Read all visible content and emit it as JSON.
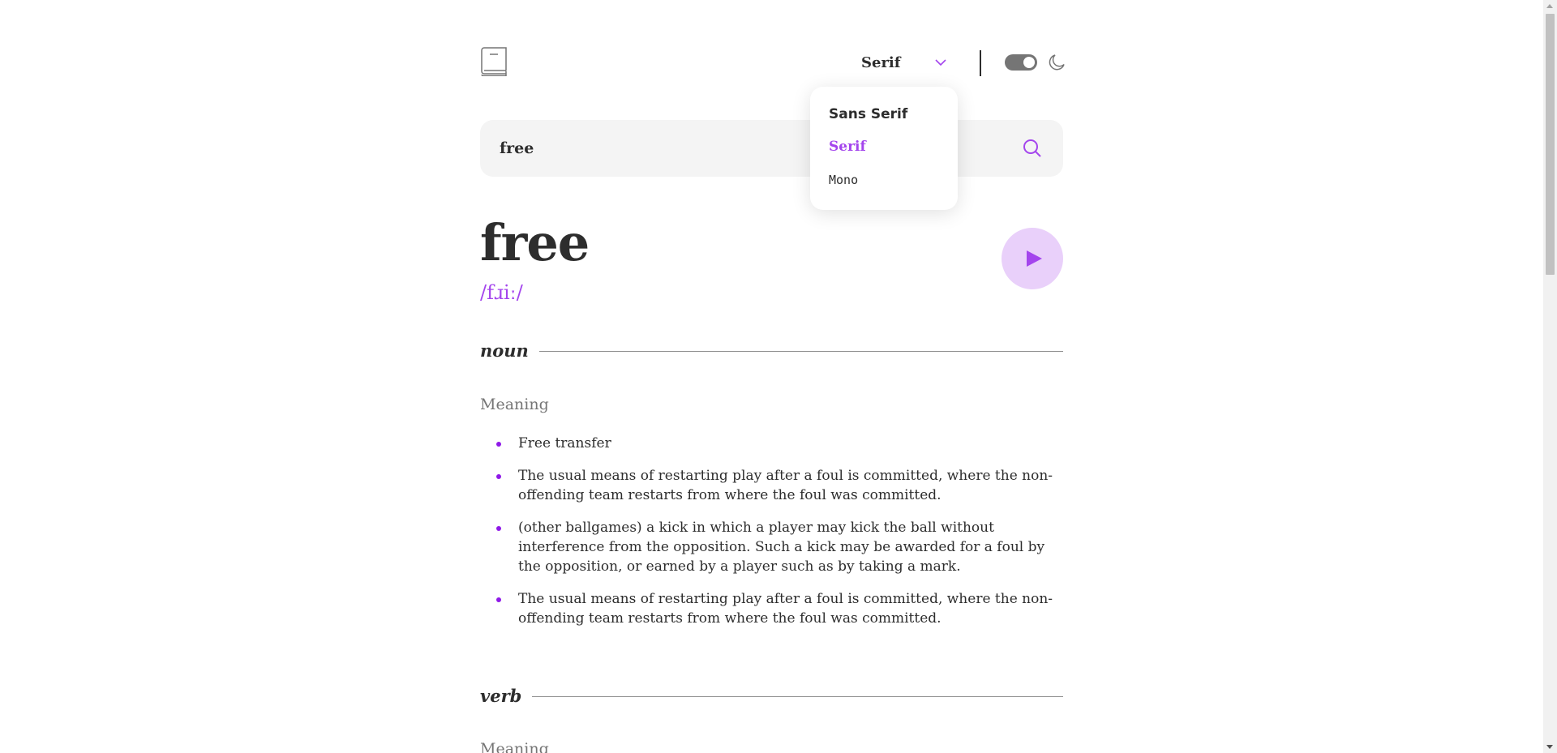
{
  "header": {
    "logo_icon": "book-icon",
    "font_select": {
      "selected": "Serif",
      "icon": "chevron-down-icon"
    },
    "theme_toggle": {
      "icon": "toggle-icon",
      "state": "on"
    },
    "moon_icon": "moon-icon"
  },
  "font_dropdown": {
    "options": [
      "Sans Serif",
      "Serif",
      "Mono"
    ],
    "selected": "Serif"
  },
  "search": {
    "value": "free",
    "icon": "search-icon"
  },
  "word": {
    "title": "free",
    "phonetic": "/fɹiː/",
    "play_icon": "play-icon"
  },
  "meanings": [
    {
      "part_of_speech": "noun",
      "meaning_label": "Meaning",
      "definitions": [
        "Free transfer",
        "The usual means of restarting play after a foul is committed, where the non-offending team restarts from where the foul was committed.",
        "(other ballgames) a kick in which a player may kick the ball without interference from the opposition. Such a kick may be awarded for a foul by the opposition, or earned by a player such as by taking a mark.",
        "The usual means of restarting play after a foul is committed, where the non-offending team restarts from where the foul was committed."
      ]
    },
    {
      "part_of_speech": "verb",
      "meaning_label": "Meaning"
    }
  ],
  "colors": {
    "accent": "#a445ed",
    "text": "#2d2d2d",
    "muted": "#757575",
    "search_bg": "#f4f4f4",
    "play_bg": "#e9d0fa"
  }
}
